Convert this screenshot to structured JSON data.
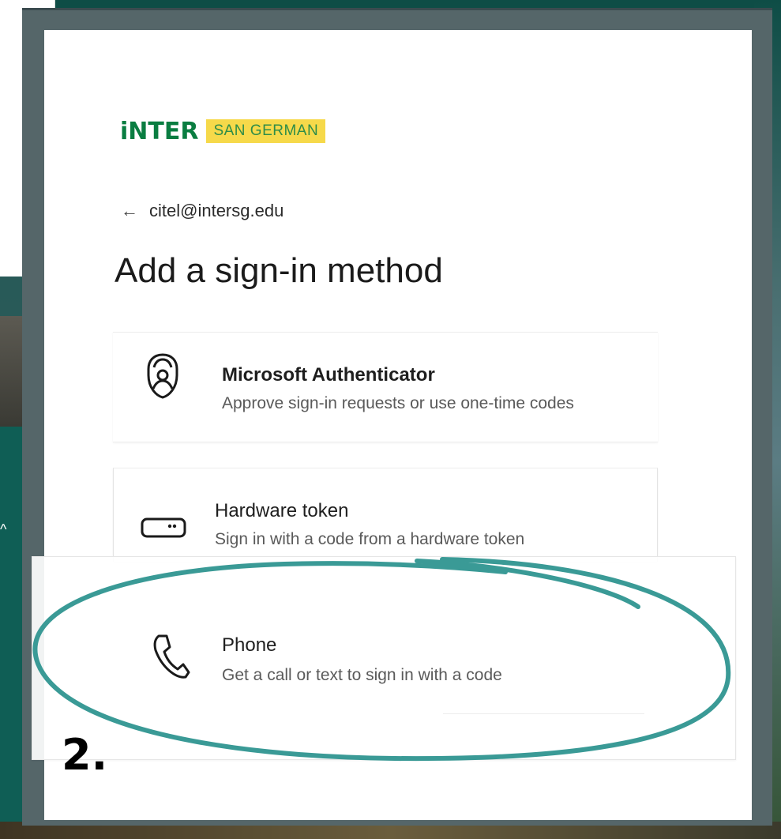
{
  "logo": {
    "inter": "iNTER",
    "campus": "SAN GERMAN"
  },
  "account": {
    "back_icon": "arrow-left-icon",
    "email": "citel@intersg.edu"
  },
  "heading": "Add a sign-in method",
  "methods": [
    {
      "icon": "authenticator-lock-icon",
      "title": "Microsoft Authenticator",
      "description": "Approve sign-in requests or use one-time codes"
    },
    {
      "icon": "hardware-token-icon",
      "title": "Hardware token",
      "description": "Sign in with a code from a hardware token"
    },
    {
      "icon": "phone-icon",
      "title": "Phone",
      "description": "Get a call or text to sign in with a code"
    }
  ],
  "annotation": {
    "step": "2.",
    "color": "#3a9a96"
  },
  "colors": {
    "brand_green": "#0a7d41",
    "brand_yellow": "#f6d94a"
  }
}
